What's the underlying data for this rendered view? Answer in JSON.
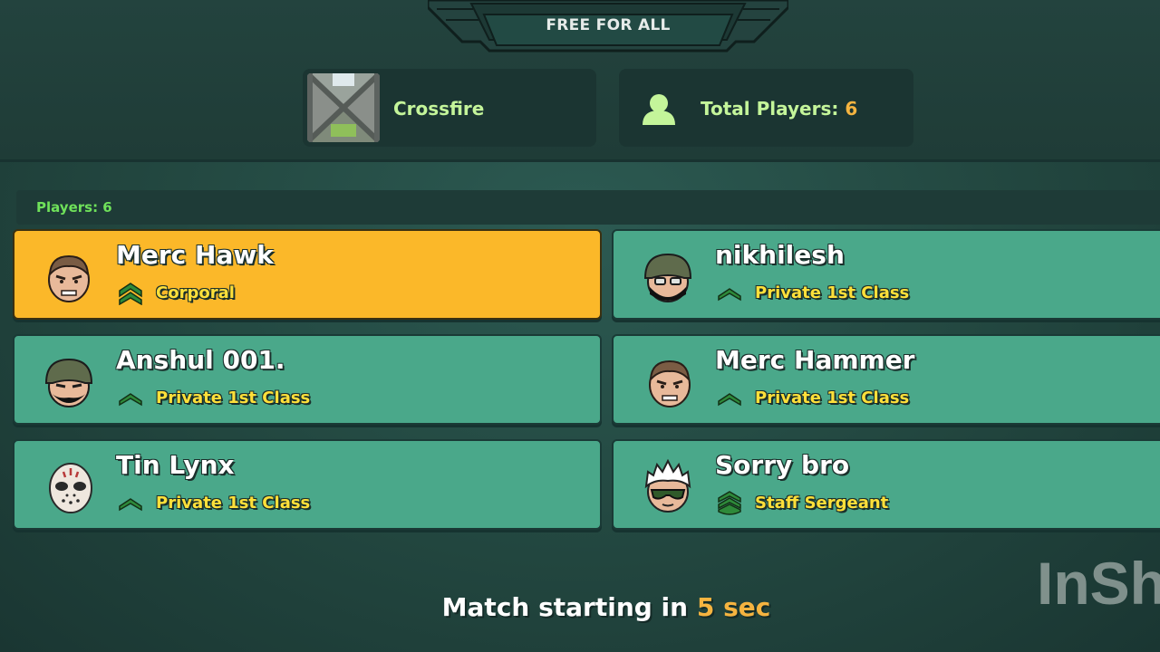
{
  "mode": {
    "title": "FREE FOR ALL"
  },
  "map": {
    "name": "Crossfire"
  },
  "total_players": {
    "label": "Total Players: ",
    "count": "6"
  },
  "list": {
    "header": "Players: 6"
  },
  "players": [
    {
      "name": "Merc Hawk",
      "rank": "Corporal",
      "avatar": "soldier-face-icon",
      "rank_icon": "corporal-chevron-icon",
      "highlight": true
    },
    {
      "name": "nikhilesh",
      "rank": "Private 1st Class",
      "avatar": "helmet-masked-soldier-icon",
      "rank_icon": "pfc-chevron-icon"
    },
    {
      "name": "Anshul 001.",
      "rank": "Private 1st Class",
      "avatar": "helmet-bearded-soldier-icon",
      "rank_icon": "pfc-chevron-icon"
    },
    {
      "name": "Merc Hammer",
      "rank": "Private 1st Class",
      "avatar": "soldier-face-icon",
      "rank_icon": "pfc-chevron-icon"
    },
    {
      "name": "Tin Lynx",
      "rank": "Private 1st Class",
      "avatar": "hockey-mask-icon",
      "rank_icon": "pfc-chevron-icon"
    },
    {
      "name": "Sorry bro",
      "rank": "Staff Sergeant",
      "avatar": "white-hair-sunglasses-icon",
      "rank_icon": "staff-sergeant-chevron-icon"
    }
  ],
  "status": {
    "prefix": "Match starting in ",
    "seconds": "5 sec"
  },
  "watermark": {
    "text": "InSh"
  },
  "colors": {
    "card": "#4aa88a",
    "highlight": "#fbb829",
    "accent_green": "#c4f59a",
    "accent_orange": "#f5b440",
    "rank_text": "#ffe03a"
  }
}
